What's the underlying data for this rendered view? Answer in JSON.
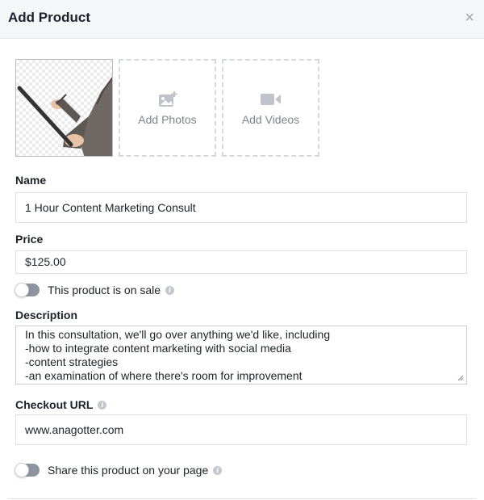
{
  "dialog": {
    "title": "Add Product",
    "close_icon": "×"
  },
  "media": {
    "thumbnail_alt": "Product image: hand holding tablet and stylus",
    "add_photos_label": "Add Photos",
    "add_videos_label": "Add Videos"
  },
  "form": {
    "name_label": "Name",
    "name_value": "1 Hour Content Marketing Consult",
    "price_label": "Price",
    "price_value": "$125.00",
    "on_sale_label": "This product is on sale",
    "on_sale_enabled": false,
    "description_label": "Description",
    "description_lines": [
      "In this consultation, we'll go over anything we'd like, including",
      "-how to integrate content marketing with social media",
      "-content strategies",
      "-an examination of where there's room for improvement"
    ],
    "checkout_url_label": "Checkout URL",
    "checkout_url_value": "www.anagotter.com",
    "share_label": "Share this product on your page",
    "share_enabled": false,
    "info_icon": "i"
  }
}
